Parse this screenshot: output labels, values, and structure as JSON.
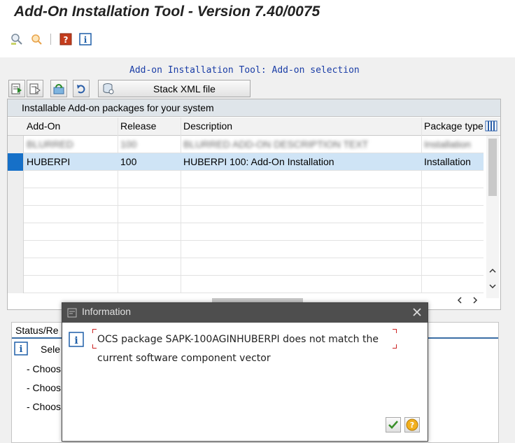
{
  "window": {
    "title": "Add-On Installation Tool - Version 7.40/0075"
  },
  "toolbar": {
    "icons": [
      "find-icon",
      "find-next-icon",
      "help-icon",
      "info-icon"
    ]
  },
  "screen": {
    "subtitle": "Add-on Installation Tool: Add-on selection"
  },
  "actions": {
    "stack_xml_label": "Stack XML file"
  },
  "table": {
    "caption": "Installable Add-on packages for your system",
    "columns": [
      "Add-On",
      "Release",
      "Description",
      "Package type"
    ],
    "rows": [
      {
        "addon": "BLURRED",
        "release": "100",
        "description": "BLURRED ADD-ON DESCRIPTION TEXT",
        "type": "Installation",
        "blurred": true
      },
      {
        "addon": "HUBERPI",
        "release": "100",
        "description": "HUBERPI 100: Add-On Installation",
        "type": "Installation",
        "selected": true
      }
    ]
  },
  "status": {
    "tab_label": "Status/Re",
    "lines": [
      "Sele",
      "- Choos",
      "- Choos",
      "- Choos"
    ]
  },
  "dialog": {
    "title": "Information",
    "message_line1": "OCS package SAPK-100AGINHUBERPI does not match the",
    "message_line2": "current software component vector",
    "colors": {
      "titlebar": "#4e4e4e",
      "ok": "#3a8f2a",
      "help": "#e8a400"
    }
  }
}
